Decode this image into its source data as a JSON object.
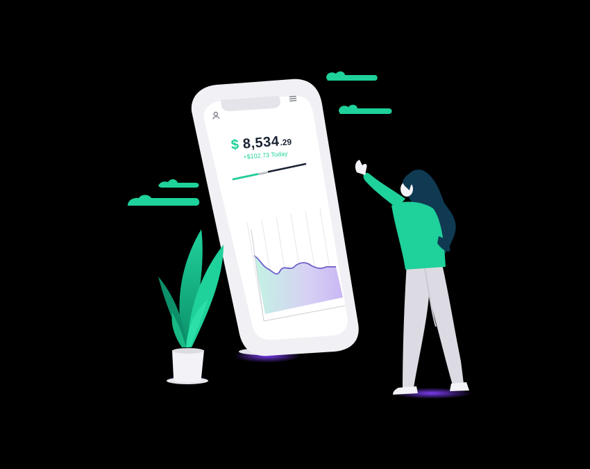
{
  "wallet": {
    "currency_symbol": "$",
    "balance_whole": "8,534",
    "balance_cents": ".29",
    "change_today": "+$102.73 Today",
    "progress": 0.35
  },
  "icons": {
    "profile": "user-icon",
    "menu": "hamburger-menu-icon"
  },
  "colors": {
    "accent": "#1fd19a",
    "dark_text": "#1a2233",
    "navy": "#0f3a52",
    "phone_body": "#f1f0f4",
    "purple": "#7b3cf0"
  }
}
